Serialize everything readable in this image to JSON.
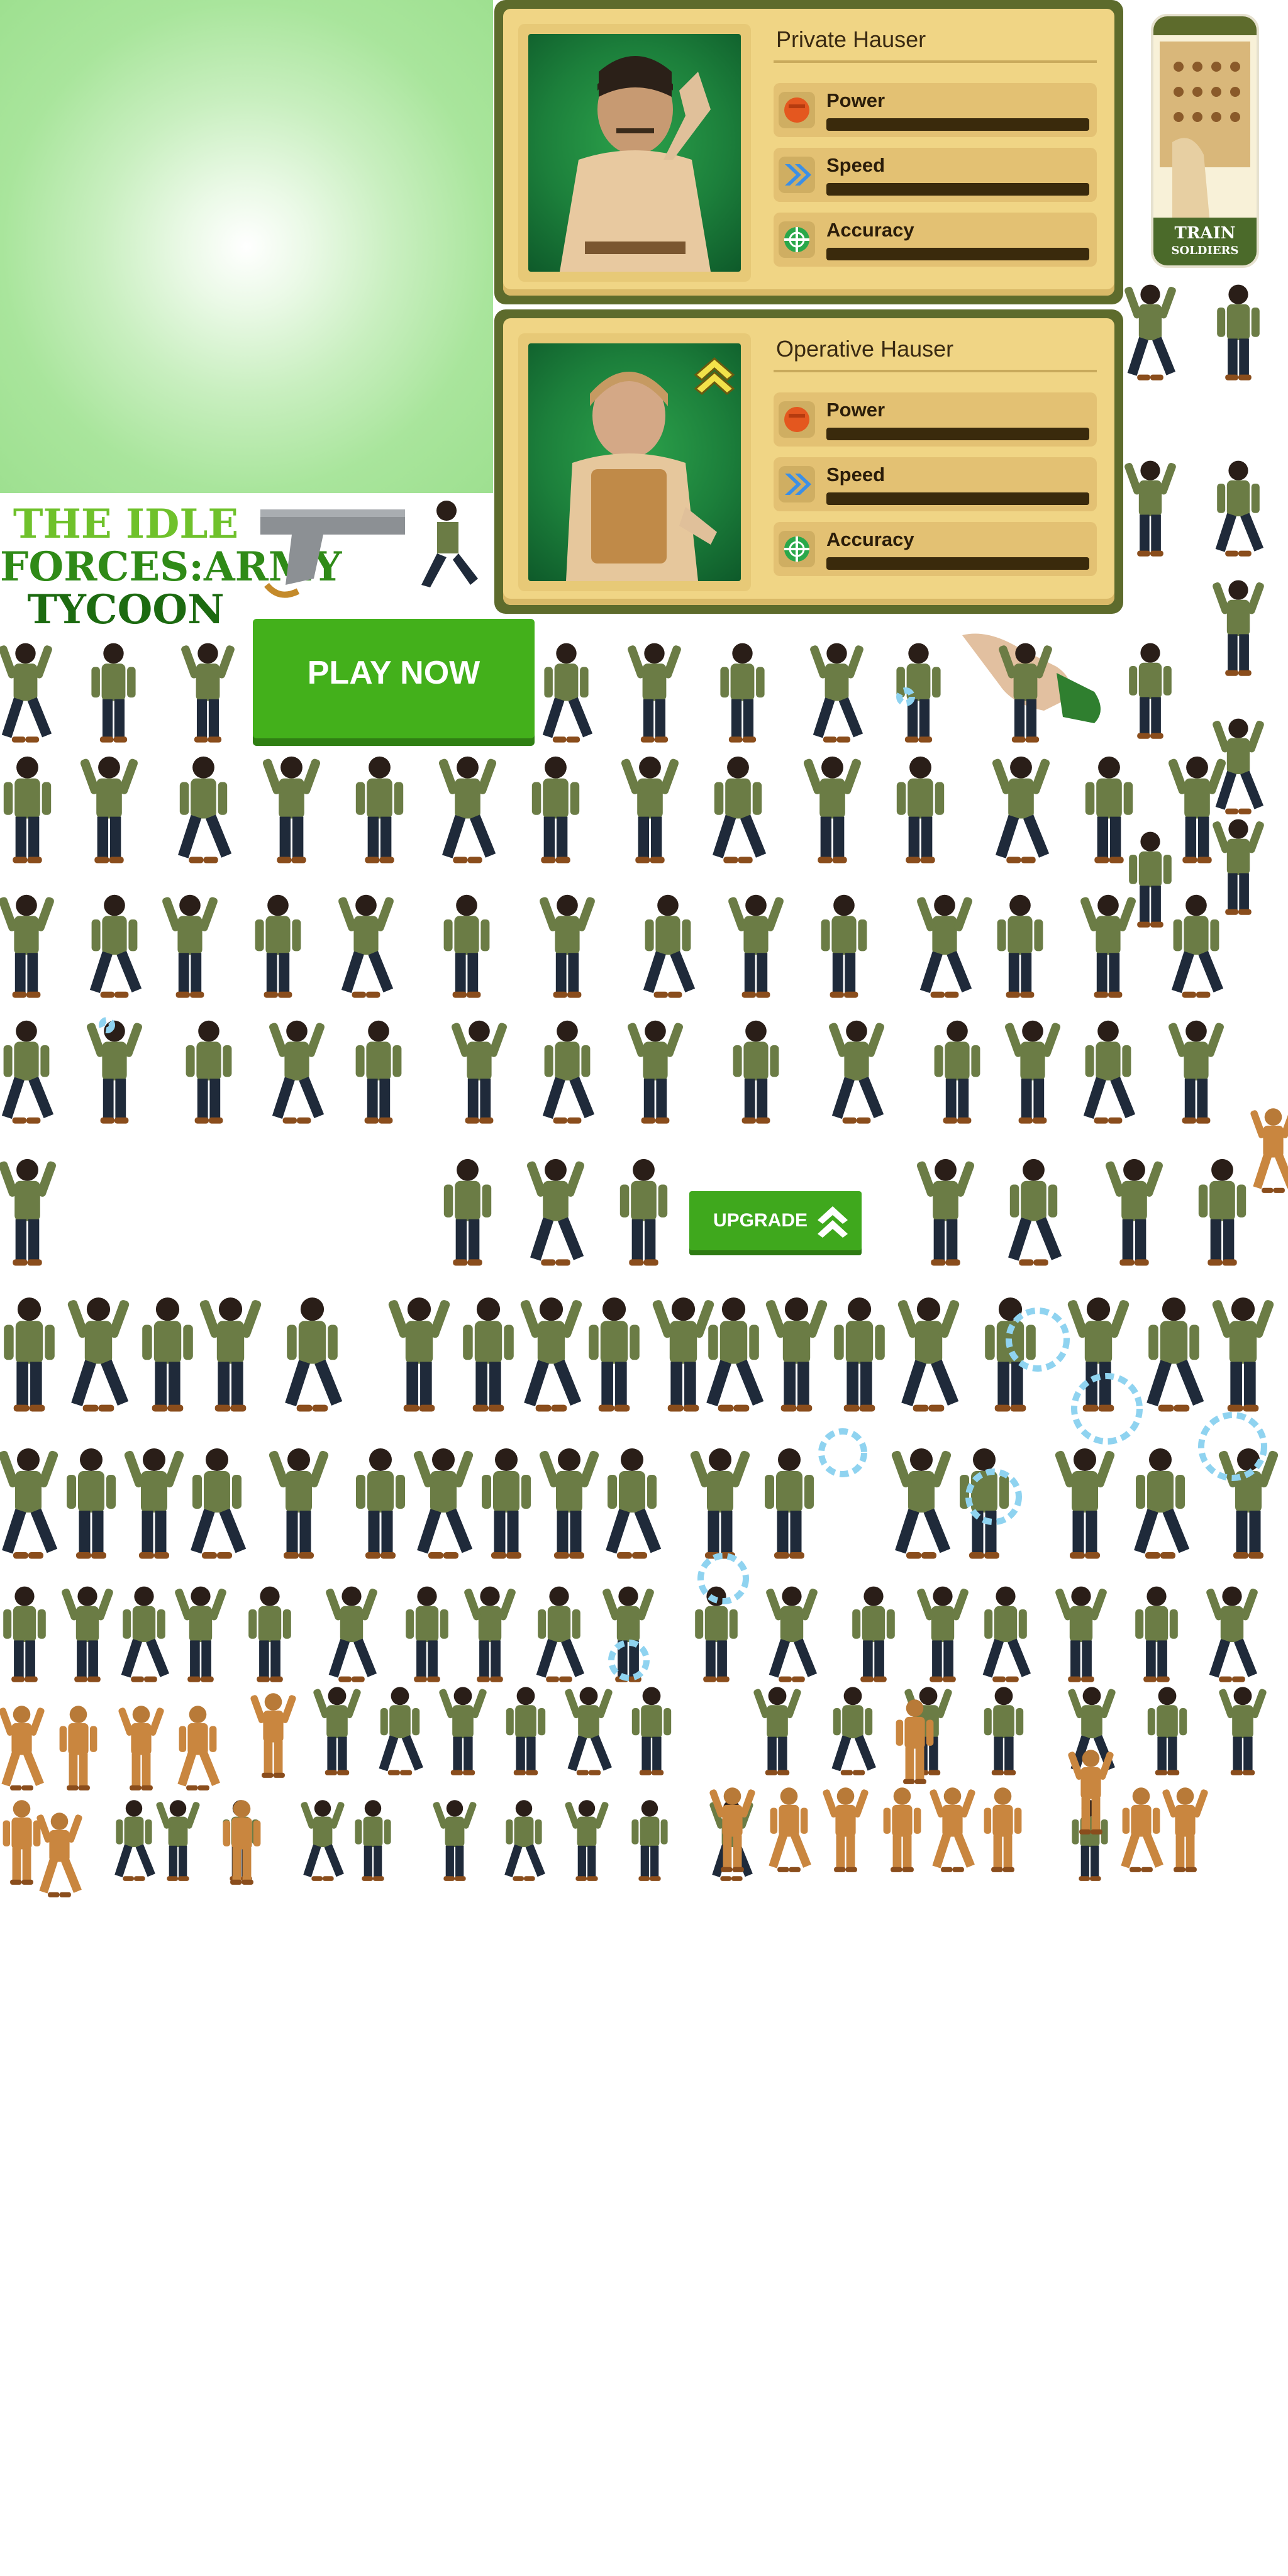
{
  "cards": [
    {
      "name": "Private Hauser",
      "rank_badge": false,
      "stats": [
        {
          "label": "Power",
          "icon": "fist-icon",
          "icon_color": "#e4571f",
          "value": 0
        },
        {
          "label": "Speed",
          "icon": "chevrons-right-icon",
          "icon_color": "#3b8fe6",
          "value": 0
        },
        {
          "label": "Accuracy",
          "icon": "crosshair-icon",
          "icon_color": "#2aa84a",
          "value": 0
        }
      ]
    },
    {
      "name": "Operative Hauser",
      "rank_badge": true,
      "stats": [
        {
          "label": "Power",
          "icon": "fist-icon",
          "icon_color": "#e4571f",
          "value": 0
        },
        {
          "label": "Speed",
          "icon": "chevrons-right-icon",
          "icon_color": "#3b8fe6",
          "value": 0
        },
        {
          "label": "Accuracy",
          "icon": "crosshair-icon",
          "icon_color": "#2aa84a",
          "value": 0
        }
      ]
    }
  ],
  "game_title": {
    "line1": "THE IDLE",
    "line2": "FORCES:ARMY",
    "line3": "TYCOON"
  },
  "buttons": {
    "play_now": "PLAY NOW",
    "upgrade": "UPGRADE"
  },
  "ad_phone": {
    "caption_line1": "TRAIN",
    "caption_line2": "SOLDIERS"
  },
  "colors": {
    "accent_green": "#43b01b",
    "card_frame": "#5d6b2c",
    "card_fill": "#f0d585",
    "soldier_shirt": "#6b7c45",
    "soldier_pants": "#1f2a3a",
    "armored_soldier": "#c9863f",
    "smoke_fx": "#8fd3f0"
  }
}
